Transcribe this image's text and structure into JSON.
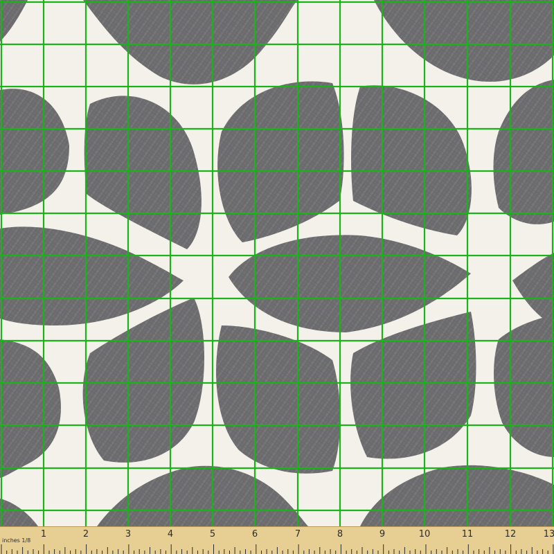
{
  "fabric": {
    "background_color": "#f4f1ea",
    "shape_color": "#6b6b6d",
    "grid_color": "#18b418",
    "grid_divisions": 13
  },
  "ruler": {
    "unit_label": "inches 1/8",
    "numbers": [
      "1",
      "2",
      "3",
      "4",
      "5",
      "6",
      "7",
      "8",
      "9",
      "10",
      "11",
      "12",
      "13"
    ],
    "color": "#e7cf94"
  }
}
